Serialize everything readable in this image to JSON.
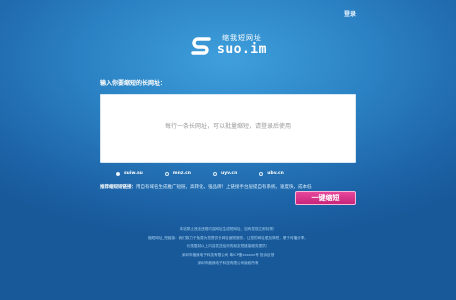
{
  "header": {
    "login_label": "登录"
  },
  "logo": {
    "cn": "缩我短网址",
    "en": "suo.im",
    "icon": "s-logo-icon"
  },
  "form": {
    "prompt": "输入你要缩短的长网址：",
    "placeholder": "每行一条长网址，可以批量缩短，请登录后使用",
    "domains": [
      {
        "label": "suiw.su",
        "selected": true
      },
      {
        "label": "mnz.cn",
        "selected": false
      },
      {
        "label": "uyv.cn",
        "selected": false
      },
      {
        "label": "ubv.cn",
        "selected": false
      }
    ],
    "reco_label": "推荐缩短短链接：",
    "reco_text": "用自有域名生成推广短链，高转化，强品牌！上链接手台层提自有系统，速度快，成本低",
    "shorten_label": "一键缩短"
  },
  "footer": {
    "lines": [
      "本站禁止违法违规内容网址生成短网址，如有发现立即封禁！",
      "缩短网址_短链接：我们致力于免费为您提供长网址缩短服务，让您的网址更加简短，便于传播分享。",
      "长按复制以上内容发送给你的朋友短链接服务提供！",
      "深圳市缩我电子科技有限公司  粤ICP备xxxxxx号  投诉反馈",
      "深圳市缩我电子科技有限公司版权所有"
    ]
  },
  "colors": {
    "accent": "#d63389",
    "background": "#2a80c2"
  }
}
